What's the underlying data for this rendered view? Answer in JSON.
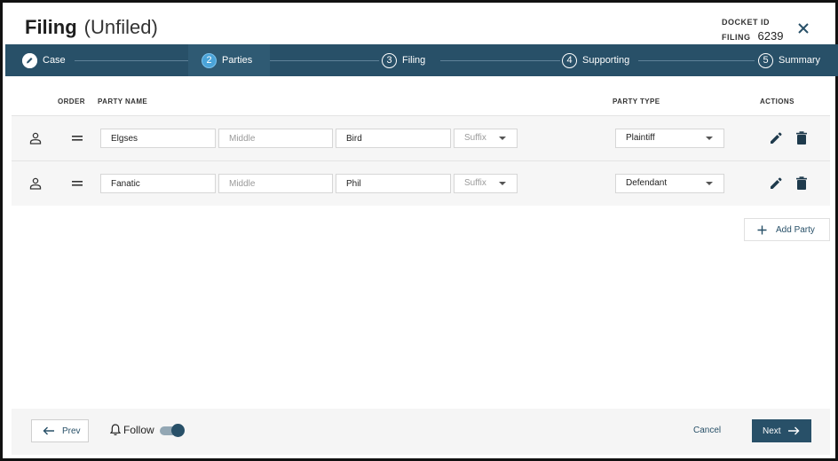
{
  "header": {
    "title": "Filing",
    "status": "(Unfiled)",
    "docket_label": "DOCKET ID",
    "filing_label": "FILING",
    "filing_number": "6239"
  },
  "stepper": {
    "steps": [
      {
        "number": "1",
        "label": "Case",
        "state": "done"
      },
      {
        "number": "2",
        "label": "Parties",
        "state": "active"
      },
      {
        "number": "3",
        "label": "Filing",
        "state": "pending"
      },
      {
        "number": "4",
        "label": "Supporting",
        "state": "pending"
      },
      {
        "number": "5",
        "label": "Summary",
        "state": "pending"
      }
    ]
  },
  "table": {
    "columns": {
      "order": "ORDER",
      "party_name": "PARTY NAME",
      "party_type": "PARTY TYPE",
      "actions": "ACTIONS"
    },
    "rows": [
      {
        "first": "Elgses",
        "middle": "",
        "middle_placeholder": "Middle",
        "last": "Bird",
        "suffix_placeholder": "Suffix",
        "party_type": "Plaintiff"
      },
      {
        "first": "Fanatic",
        "middle": "",
        "middle_placeholder": "Middle",
        "last": "Phil",
        "suffix_placeholder": "Suffix",
        "party_type": "Defendant"
      }
    ],
    "add_party_label": "Add Party"
  },
  "footer": {
    "prev_label": "Prev",
    "follow_label": "Follow",
    "follow_on": true,
    "cancel_label": "Cancel",
    "next_label": "Next"
  },
  "colors": {
    "brand": "#285068",
    "active_step": "#4aa3d8"
  }
}
